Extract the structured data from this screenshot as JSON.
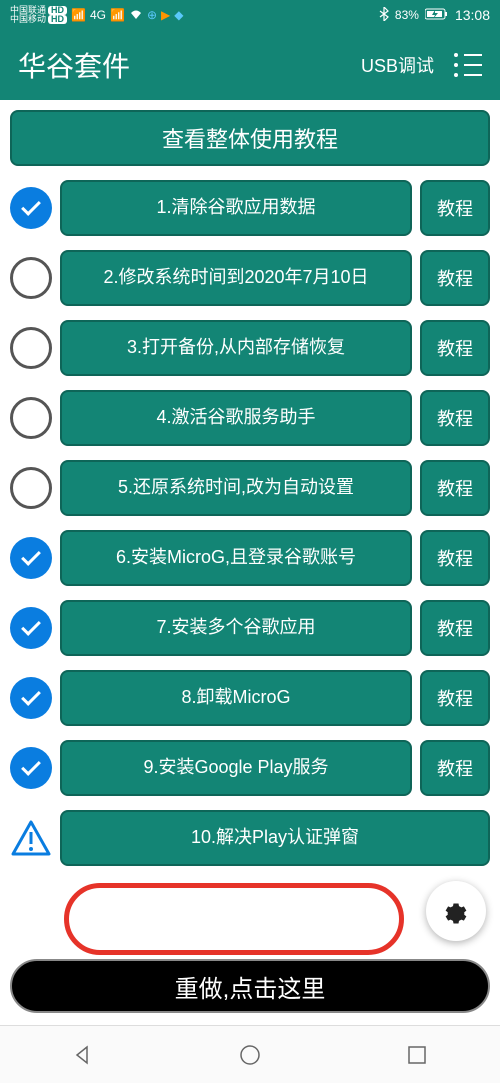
{
  "status_bar": {
    "carrier1": "中国联通",
    "carrier2": "中国移动",
    "hd": "HD",
    "signal_4g": "4G",
    "battery_text": "83%",
    "time": "13:08"
  },
  "header": {
    "title": "华谷套件",
    "usb_debug": "USB调试"
  },
  "main_button": "查看整体使用教程",
  "tutorial_label": "教程",
  "steps": [
    {
      "label": "1.清除谷歌应用数据",
      "status": "done",
      "has_tutorial": true
    },
    {
      "label": "2.修改系统时间到2020年7月10日",
      "status": "empty",
      "has_tutorial": true
    },
    {
      "label": "3.打开备份,从内部存储恢复",
      "status": "empty",
      "has_tutorial": true
    },
    {
      "label": "4.激活谷歌服务助手",
      "status": "empty",
      "has_tutorial": true
    },
    {
      "label": "5.还原系统时间,改为自动设置",
      "status": "empty",
      "has_tutorial": true
    },
    {
      "label": "6.安装MicroG,且登录谷歌账号",
      "status": "done",
      "has_tutorial": true
    },
    {
      "label": "7.安装多个谷歌应用",
      "status": "done",
      "has_tutorial": true
    },
    {
      "label": "8.卸载MicroG",
      "status": "done",
      "has_tutorial": true
    },
    {
      "label": "9.安装Google Play服务",
      "status": "done",
      "has_tutorial": true
    },
    {
      "label": "10.解决Play认证弹窗",
      "status": "warn",
      "has_tutorial": false
    }
  ],
  "redo_button": "重做,点击这里"
}
